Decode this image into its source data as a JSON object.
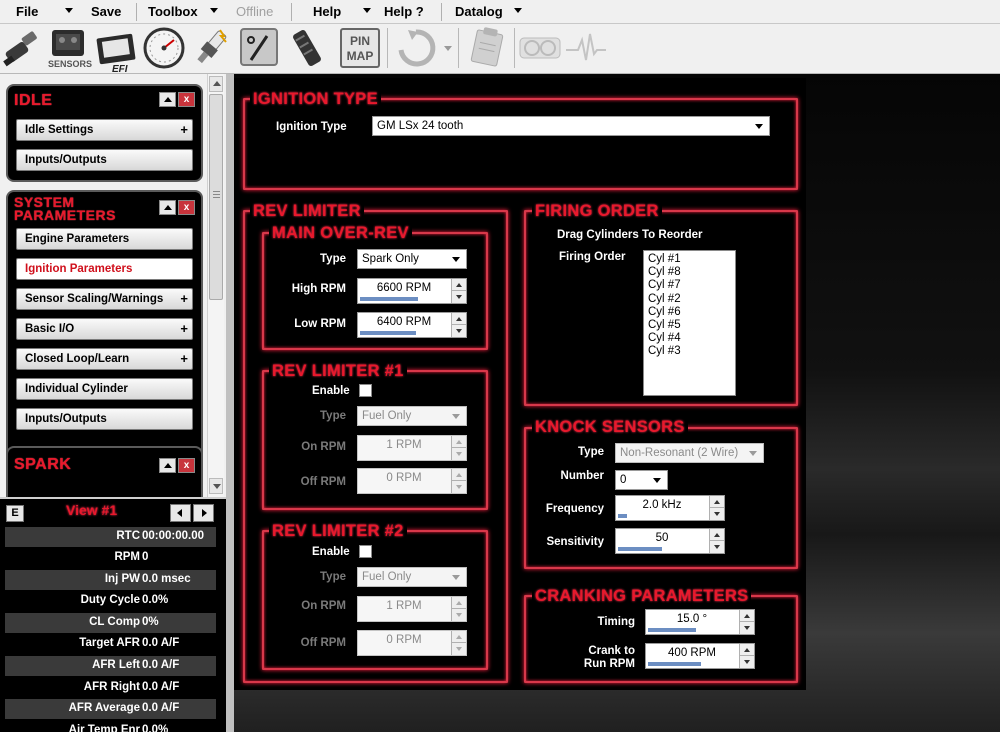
{
  "menubar": {
    "items": [
      "File",
      "Save",
      "Toolbox",
      "Offline",
      "Help",
      "Help ?",
      "Datalog"
    ]
  },
  "toolbar": {
    "sensors_label": "SENSORS",
    "efi_label": "EFI",
    "pinmap_label_1": "PIN",
    "pinmap_label_2": "MAP",
    "icons": [
      "injector-icon",
      "sensors-icon",
      "efi-ecu-icon",
      "gauge-icon",
      "spark-plug-icon",
      "ignition-percent-icon",
      "throttle-pedal-icon",
      "pin-map-icon",
      "refresh-icon",
      "clipboard-icon",
      "dash-gauges-icon",
      "heartbeat-icon"
    ]
  },
  "sidebar": {
    "groups": [
      {
        "title": "IDLE",
        "items": [
          {
            "label": "Idle Settings",
            "plus": "+"
          },
          {
            "label": "Inputs/Outputs",
            "plus": ""
          }
        ]
      },
      {
        "title_line1": "SYSTEM",
        "title_line2": "PARAMETERS",
        "items": [
          {
            "label": "Engine Parameters",
            "plus": ""
          },
          {
            "label": "Ignition Parameters",
            "plus": "",
            "active": true
          },
          {
            "label": "Sensor Scaling/Warnings",
            "plus": "+"
          },
          {
            "label": "Basic I/O",
            "plus": "+"
          },
          {
            "label": "Closed Loop/Learn",
            "plus": "+"
          },
          {
            "label": "Individual Cylinder",
            "plus": ""
          },
          {
            "label": "Inputs/Outputs",
            "plus": ""
          }
        ]
      },
      {
        "title": "SPARK"
      }
    ],
    "close_glyph": "x"
  },
  "view": {
    "e_button": "E",
    "title": "View #1",
    "rows": [
      {
        "label": "RTC",
        "value": "00:00:00.00"
      },
      {
        "label": "RPM",
        "value": "0"
      },
      {
        "label": "Inj PW",
        "value": "0.0 msec"
      },
      {
        "label": "Duty Cycle",
        "value": "0.0%"
      },
      {
        "label": "CL Comp",
        "value": "0%"
      },
      {
        "label": "Target AFR",
        "value": "0.0 A/F"
      },
      {
        "label": "AFR Left",
        "value": "0.0 A/F"
      },
      {
        "label": "AFR Right",
        "value": "0.0 A/F"
      },
      {
        "label": "AFR Average",
        "value": "0.0 A/F"
      },
      {
        "label": "Air Temp Enr",
        "value": "0.0%"
      }
    ]
  },
  "ignition_type": {
    "title": "IGNITION TYPE",
    "label": "Ignition Type",
    "value": "GM LSx 24 tooth"
  },
  "rev_limiter": {
    "title": "REV LIMITER",
    "main": {
      "title": "MAIN OVER-REV",
      "type_label": "Type",
      "type_value": "Spark Only",
      "high_label": "High RPM",
      "high_value": "6600 RPM",
      "high_fraction": 0.66,
      "low_label": "Low RPM",
      "low_value": "6400 RPM",
      "low_fraction": 0.64
    },
    "limiter1": {
      "title": "REV LIMITER #1",
      "enable_label": "Enable",
      "type_label": "Type",
      "type_value": "Fuel Only",
      "on_label": "On RPM",
      "on_value": "1 RPM",
      "off_label": "Off RPM",
      "off_value": "0 RPM"
    },
    "limiter2": {
      "title": "REV LIMITER #2",
      "enable_label": "Enable",
      "type_label": "Type",
      "type_value": "Fuel Only",
      "on_label": "On RPM",
      "on_value": "1 RPM",
      "off_label": "Off RPM",
      "off_value": "0 RPM"
    }
  },
  "firing_order": {
    "title": "FIRING ORDER",
    "hint": "Drag Cylinders To Reorder",
    "label": "Firing Order",
    "cylinders": [
      "Cyl #1",
      "Cyl #8",
      "Cyl #7",
      "Cyl #2",
      "Cyl #6",
      "Cyl #5",
      "Cyl #4",
      "Cyl #3"
    ]
  },
  "knock": {
    "title": "KNOCK SENSORS",
    "type_label": "Type",
    "type_value": "Non-Resonant (2 Wire)",
    "number_label": "Number",
    "number_value": "0",
    "freq_label": "Frequency",
    "freq_value": "2.0 kHz",
    "freq_fraction": 0.1,
    "sens_label": "Sensitivity",
    "sens_value": "50",
    "sens_fraction": 0.5
  },
  "cranking": {
    "title": "CRANKING PARAMETERS",
    "timing_label": "Timing",
    "timing_value": "15.0 °",
    "timing_fraction": 0.55,
    "crank_label_1": "Crank to",
    "crank_label_2": "Run RPM",
    "crank_value": "400 RPM",
    "crank_fraction": 0.6
  }
}
